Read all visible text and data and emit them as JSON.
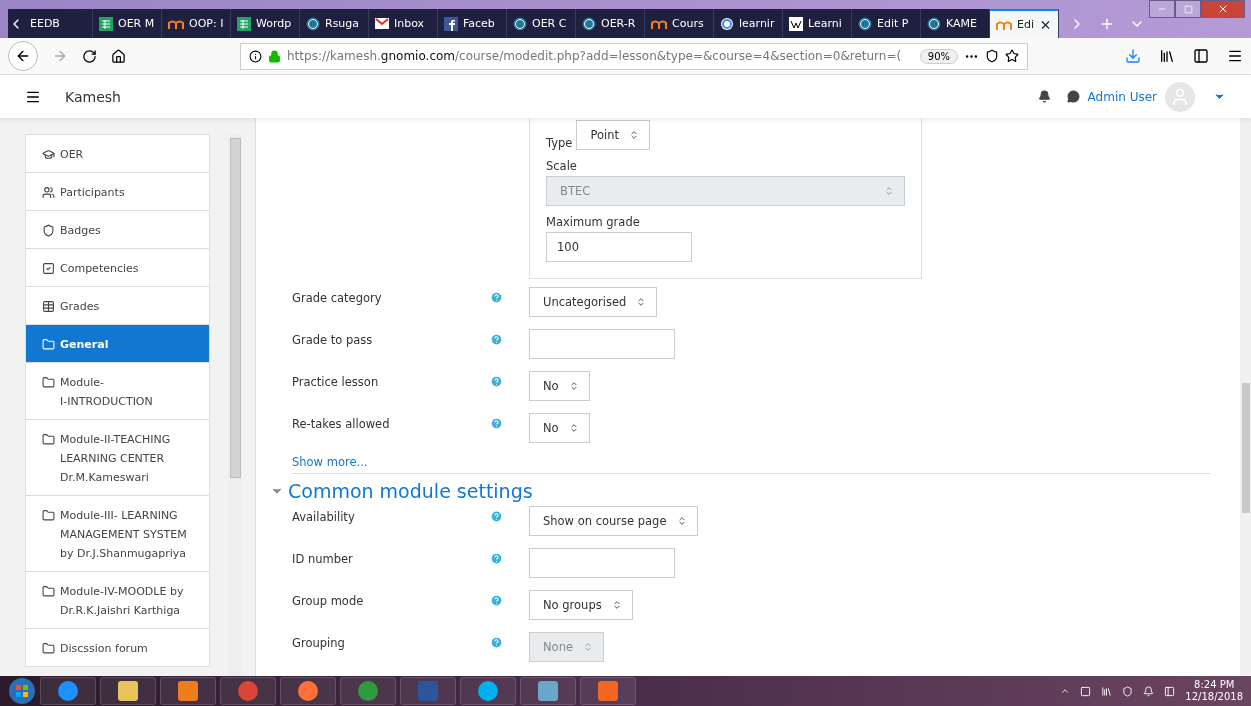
{
  "browser": {
    "tabs": [
      {
        "label": "EEDB",
        "kind": "plain",
        "selected": false
      },
      {
        "label": "OER M",
        "kind": "sheet",
        "selected": false
      },
      {
        "label": "OOP: I",
        "kind": "moodle",
        "selected": false
      },
      {
        "label": "Wordp",
        "kind": "sheet",
        "selected": false
      },
      {
        "label": "Rsuga",
        "kind": "wp",
        "selected": false
      },
      {
        "label": "Inbox",
        "kind": "mail",
        "selected": false
      },
      {
        "label": "Faceb",
        "kind": "fb",
        "selected": false
      },
      {
        "label": "OER C",
        "kind": "wp",
        "selected": false
      },
      {
        "label": "OER-R",
        "kind": "wp",
        "selected": false
      },
      {
        "label": "Cours",
        "kind": "moodle",
        "selected": false
      },
      {
        "label": "learnir",
        "kind": "google",
        "selected": false
      },
      {
        "label": "Learni",
        "kind": "wiki",
        "selected": false
      },
      {
        "label": "Edit P",
        "kind": "wp",
        "selected": false
      },
      {
        "label": "KAME",
        "kind": "wp",
        "selected": false
      },
      {
        "label": "Edi",
        "kind": "moodle",
        "selected": true
      }
    ],
    "url": {
      "prefix": "https://kamesh.",
      "domain": "gnomio.com",
      "path": "/course/modedit.php?add=lesson&type=&course=4&section=0&return=("
    },
    "zoom": "90%"
  },
  "header": {
    "site": "Kamesh",
    "user": "Admin User"
  },
  "sidebar": {
    "items": [
      {
        "label": "OER",
        "kind": "course",
        "selected": false
      },
      {
        "label": "Participants",
        "kind": "participants",
        "selected": false
      },
      {
        "label": "Badges",
        "kind": "badges",
        "selected": false
      },
      {
        "label": "Competencies",
        "kind": "competencies",
        "selected": false
      },
      {
        "label": "Grades",
        "kind": "grades",
        "selected": false
      },
      {
        "label": "General",
        "kind": "section",
        "selected": true
      },
      {
        "label": "Module-\nI-INTRODUCTION",
        "kind": "section",
        "selected": false
      },
      {
        "label": "Module-II-TEACHING\nLEARNING CENTER\nDr.M.Kameswari",
        "kind": "section",
        "selected": false
      },
      {
        "label": "Module-III- LEARNING\nMANAGEMENT SYSTEM\nby Dr.J.Shanmugapriya",
        "kind": "section",
        "selected": false
      },
      {
        "label": "Module-IV-MOODLE by\nDr.R.K.Jaishri Karthiga",
        "kind": "section",
        "selected": false
      },
      {
        "label": "Discssion forum",
        "kind": "section",
        "selected": false
      }
    ]
  },
  "grade_box": {
    "type_label": "Type",
    "type_value": "Point",
    "scale_label": "Scale",
    "scale_value": "BTEC",
    "scale_disabled": true,
    "max_label": "Maximum grade",
    "max_value": "100"
  },
  "rows": [
    {
      "label": "Grade category",
      "kind": "select",
      "value": "Uncategorised"
    },
    {
      "label": "Grade to pass",
      "kind": "text"
    },
    {
      "label": "Practice lesson",
      "kind": "select",
      "value": "No"
    },
    {
      "label": "Re-takes allowed",
      "kind": "select",
      "value": "No"
    }
  ],
  "show_more": "Show more...",
  "section": {
    "title": "Common module settings",
    "expanded": true,
    "rows": [
      {
        "label": "Availability",
        "kind": "select",
        "value": "Show on course page"
      },
      {
        "label": "ID number",
        "kind": "text"
      },
      {
        "label": "Group mode",
        "kind": "select",
        "value": "No groups"
      },
      {
        "label": "Grouping",
        "kind": "locked-select",
        "value": "None"
      }
    ]
  },
  "taskbar": {
    "apps": [
      {
        "kind": "ie"
      },
      {
        "kind": "folder"
      },
      {
        "kind": "media"
      },
      {
        "kind": "chrome"
      },
      {
        "kind": "firefox"
      },
      {
        "kind": "icd"
      },
      {
        "kind": "word"
      },
      {
        "kind": "skype"
      },
      {
        "kind": "photo"
      },
      {
        "kind": "pdf"
      }
    ],
    "time": "8:24 PM",
    "date": "12/18/2018"
  }
}
